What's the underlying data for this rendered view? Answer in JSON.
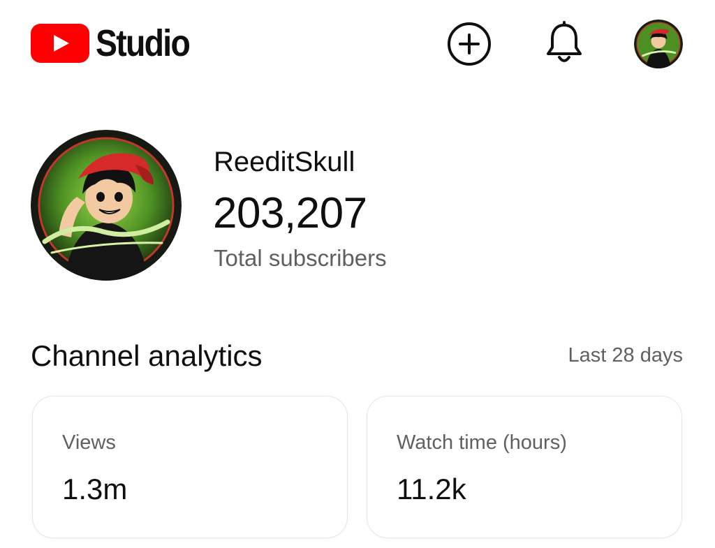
{
  "header": {
    "brand_text": "Studio",
    "logo_icon": "youtube-play-icon",
    "create_icon": "add-circle-icon",
    "notifications_icon": "bell-icon",
    "account_icon": "channel-avatar",
    "avatar_lettering": "ReeditSkull"
  },
  "channel": {
    "name": "ReeditSkull",
    "subscriber_count": "203,207",
    "subscriber_label": "Total subscribers",
    "avatar_lettering": "ReeditSkull"
  },
  "analytics": {
    "title": "Channel analytics",
    "period": "Last 28 days",
    "cards": [
      {
        "label": "Views",
        "value": "1.3m"
      },
      {
        "label": "Watch time (hours)",
        "value": "11.2k"
      }
    ]
  },
  "colors": {
    "brand_red": "#ff0000",
    "text_primary": "#0f0f0f",
    "text_secondary": "#606060",
    "card_border": "#e6e6e6",
    "avatar_green": "#5fae2a",
    "avatar_dark": "#1a1f14"
  }
}
